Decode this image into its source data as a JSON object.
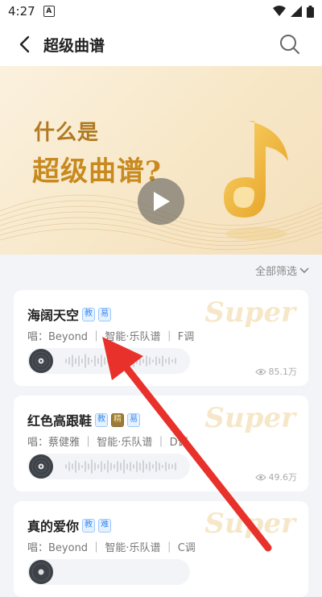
{
  "status_bar": {
    "time": "4:27",
    "notification_icon": "a-icon",
    "icons": [
      "wifi-icon",
      "signal-icon",
      "battery-icon"
    ]
  },
  "header": {
    "title": "超级曲谱",
    "back_icon": "back-arrow-icon",
    "search_icon": "search-icon"
  },
  "banner": {
    "line1": "什么是",
    "line2": "超级曲谱?",
    "play_icon": "play-icon"
  },
  "filter": {
    "label": "全部筛选"
  },
  "songs": [
    {
      "title": "海阔天空",
      "tags": [
        "教",
        "易"
      ],
      "meta": "唱：Beyond ｜ 智能·乐队谱 ｜ F调",
      "views": "85.1万",
      "watermark": "Super"
    },
    {
      "title": "红色高跟鞋",
      "tags": [
        "教",
        "精",
        "易"
      ],
      "meta": "唱：蔡健雅 ｜ 智能·乐队谱 ｜ D调",
      "views": "49.6万",
      "watermark": "Super"
    },
    {
      "title": "真的爱你",
      "tags": [
        "教",
        "难"
      ],
      "meta": "唱：Beyond ｜ 智能·乐队谱 ｜ C调",
      "views": "",
      "watermark": "Super"
    }
  ],
  "colors": {
    "accent_gold": "#c88a1f",
    "tag_blue": "#3b8bf0",
    "arrow_red": "#e8312b"
  }
}
